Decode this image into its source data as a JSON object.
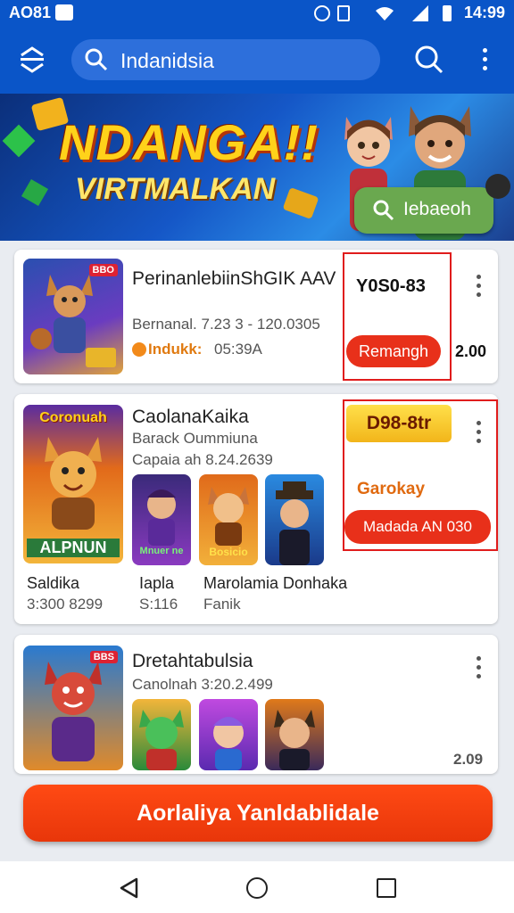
{
  "status": {
    "left": "AO81",
    "time": "14:99"
  },
  "search": {
    "query": "Indanidsia"
  },
  "banner": {
    "title": "NDANGA!!",
    "subtitle": "VIRTMALKAN",
    "button": "Iebaeoh"
  },
  "card1": {
    "title": "PerinanlebiinShGIK AAV",
    "sub": "Bernanal. 7.23 3 - 120.0305",
    "badge": "Indukk:",
    "badge_value": "05:39A",
    "price": "Y0S0-83",
    "button": "Remangh",
    "side_value": "2.00",
    "thumb_tag": "BBO"
  },
  "card2": {
    "title": "CaolanaKaika",
    "sub1": "Barack Oummiuna",
    "sub2": "Capaia ah 8.24.2639",
    "price": "D98-8tr",
    "status": "Garokay",
    "button": "Madada AN 030",
    "main_thumb_top": "Coronuah",
    "main_thumb_bottom": "ALPNUN",
    "label_main": "Saldika",
    "value_main": "3:300 8299",
    "label_mid": "Iapla",
    "value_mid": "S:116",
    "label_right": "Marolamia Donhaka",
    "value_right": "Fanik",
    "tile1_label": "Mnuer ne",
    "tile2_label": "Bosicio"
  },
  "card3": {
    "title": "Dretahtabulsia",
    "sub": "Canolnah 3:20.2.499",
    "value": "2.09",
    "thumb_tag": "BBS"
  },
  "cta": {
    "label": "Aorlaliya Yanldablidale"
  },
  "colors": {
    "brand": "#0a55c8",
    "accent": "#e8301a",
    "highlight": "#ffd21a"
  }
}
